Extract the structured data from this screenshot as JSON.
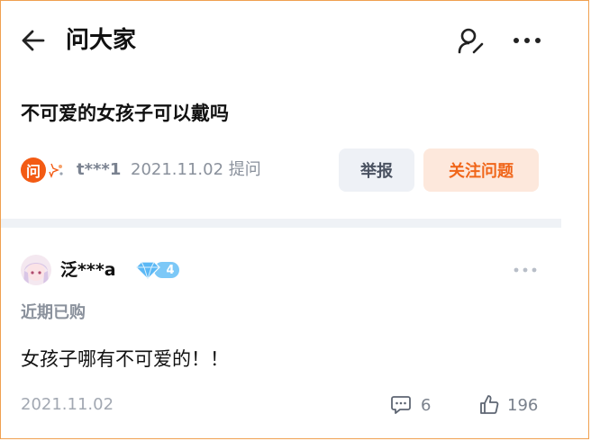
{
  "header": {
    "title": "问大家",
    "back_icon": "arrow-left-icon",
    "profile_icon": "user-edit-icon",
    "more_icon": "more-horizontal-icon"
  },
  "question": {
    "title": "不可爱的女孩子可以戴吗",
    "ask_badge": "问",
    "asker_name": "t***1",
    "asker_meta": "2021.11.02 提问",
    "report_label": "举报",
    "follow_label": "关注问题"
  },
  "answer": {
    "answerer_name": "泛***a",
    "vip_level": "4",
    "tag": "近期已购",
    "text": "女孩子哪有不可爱的！！",
    "date": "2021.11.02",
    "comment_count": "6",
    "like_count": "196"
  },
  "colors": {
    "accent": "#f35b14",
    "follow_bg": "#fde8dc",
    "report_bg": "#eef1f6",
    "divider": "#eff2f6",
    "vip": "#5bb8f5"
  }
}
